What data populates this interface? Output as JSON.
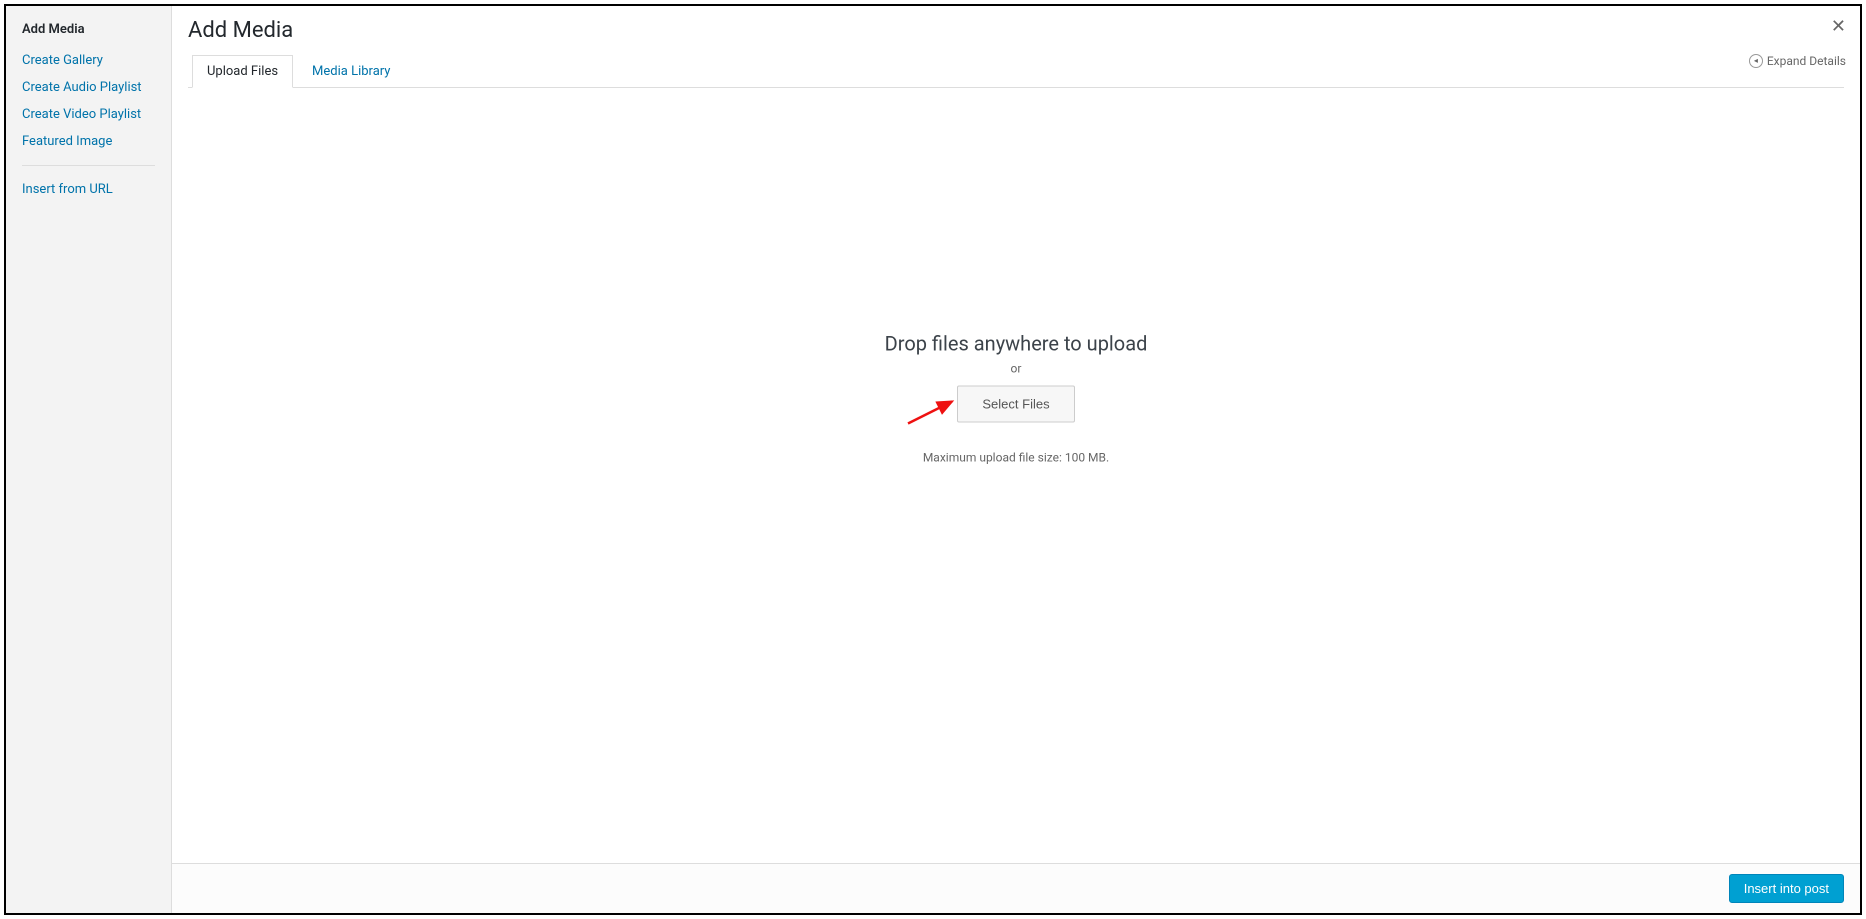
{
  "sidebar": {
    "heading": "Add Media",
    "links_top": [
      "Create Gallery",
      "Create Audio Playlist",
      "Create Video Playlist",
      "Featured Image"
    ],
    "link_bottom": "Insert from URL"
  },
  "header": {
    "title": "Add Media",
    "tabs": [
      "Upload Files",
      "Media Library"
    ],
    "active_tab_index": 0,
    "expand_details": "Expand Details"
  },
  "upload": {
    "drop_text": "Drop files anywhere to upload",
    "or_text": "or",
    "select_files": "Select Files",
    "max_size": "Maximum upload file size: 100 MB."
  },
  "footer": {
    "insert_button": "Insert into post"
  }
}
